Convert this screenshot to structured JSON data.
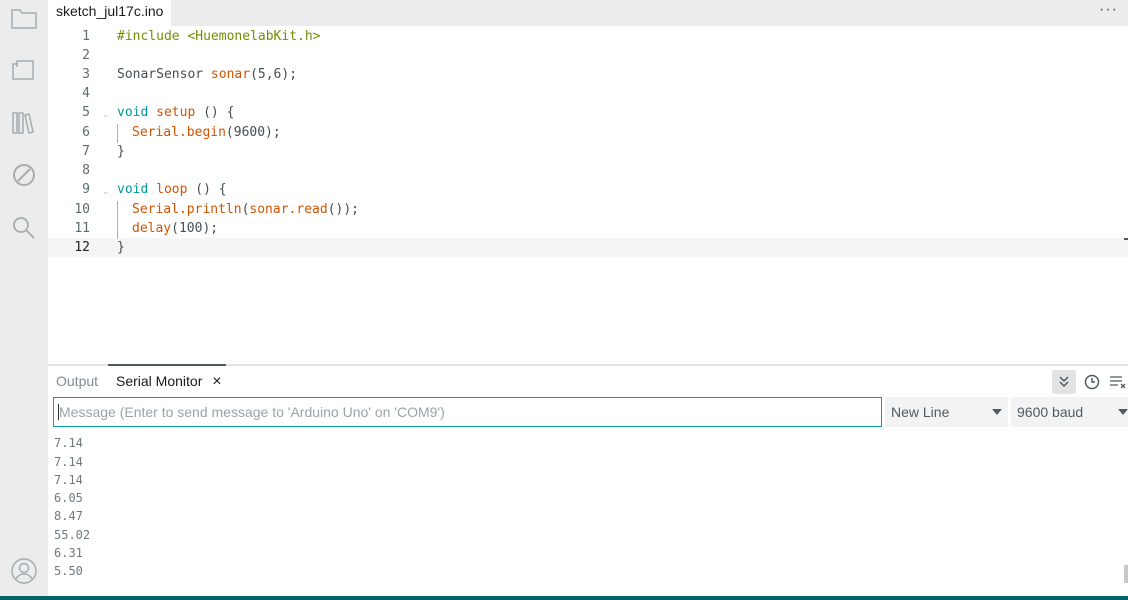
{
  "sidebar": {
    "items": [
      {
        "icon": "folder-icon"
      },
      {
        "icon": "board-icon"
      },
      {
        "icon": "library-icon"
      },
      {
        "icon": "debug-icon"
      },
      {
        "icon": "search-icon"
      }
    ],
    "profile_icon": "profile-icon"
  },
  "tabs": {
    "file_name": "sketch_jul17c.ino",
    "more": "···"
  },
  "editor": {
    "current_line": 12,
    "lines": [
      {
        "n": "1"
      },
      {
        "n": "2"
      },
      {
        "n": "3"
      },
      {
        "n": "4"
      },
      {
        "n": "5"
      },
      {
        "n": "6"
      },
      {
        "n": "7"
      },
      {
        "n": "8"
      },
      {
        "n": "9"
      },
      {
        "n": "10"
      },
      {
        "n": "11"
      },
      {
        "n": "12"
      }
    ],
    "code": {
      "l1_directive": "#include",
      "l1_header": "<HuemonelabKit.h>",
      "l3_type": "SonarSensor",
      "l3_fn": "sonar",
      "l3_args": "(5,6);",
      "l5_void": "void",
      "l5_fn": "setup",
      "l5_rest": " () {",
      "l6_fn": "Serial.begin",
      "l6_args": "(9600);",
      "l7": "}",
      "l9_void": "void",
      "l9_fn": "loop",
      "l9_rest": " () {",
      "l10_fn": "Serial.println",
      "l10_open": "(",
      "l10_fn2": "sonar.read",
      "l10_close": "());",
      "l11_fn": "delay",
      "l11_args": "(100);",
      "l12": "}"
    }
  },
  "panel": {
    "tab_output": "Output",
    "tab_serial": "Serial Monitor",
    "close": "×",
    "message_placeholder": "Message (Enter to send message to 'Arduino Uno' on 'COM9')",
    "line_ending": "New Line",
    "baud": "9600 baud",
    "output_lines": [
      "7.14",
      "7.14",
      "7.14",
      "6.05",
      "8.47",
      "55.02",
      "6.31",
      "5.50"
    ]
  },
  "colors": {
    "accent": "#0ca1a6",
    "statusbar": "#006468",
    "keyword": "#00979c",
    "function": "#d35400",
    "include": "#728e00"
  }
}
